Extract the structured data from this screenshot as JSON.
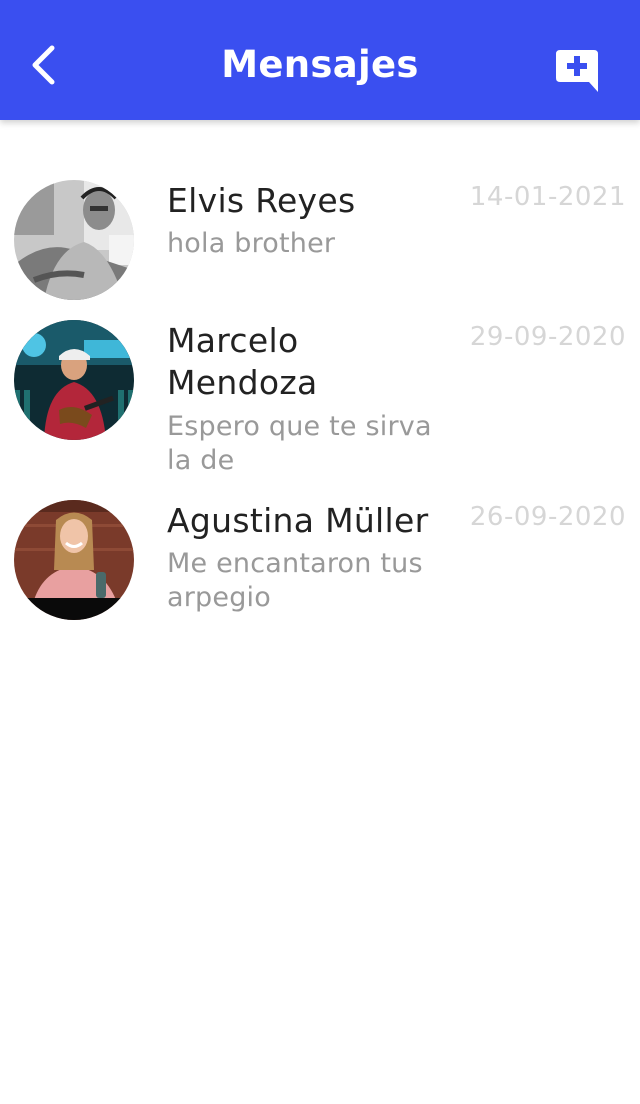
{
  "header": {
    "title": "Mensajes",
    "back_icon": "chevron-left-icon",
    "new_message_icon": "add-comment-icon"
  },
  "colors": {
    "header_bg": "#3a4ff0",
    "name_text": "#222222",
    "preview_text": "#999999",
    "date_text": "#d6d6d6"
  },
  "conversations": [
    {
      "name": "Elvis Reyes",
      "preview": "hola brother",
      "date": "14-01-2021"
    },
    {
      "name": "Marcelo Mendoza",
      "preview": "Espero que te sirva la de",
      "date": "29-09-2020"
    },
    {
      "name": "Agustina Müller",
      "preview": "Me encantaron tus arpegio",
      "date": "26-09-2020"
    }
  ]
}
